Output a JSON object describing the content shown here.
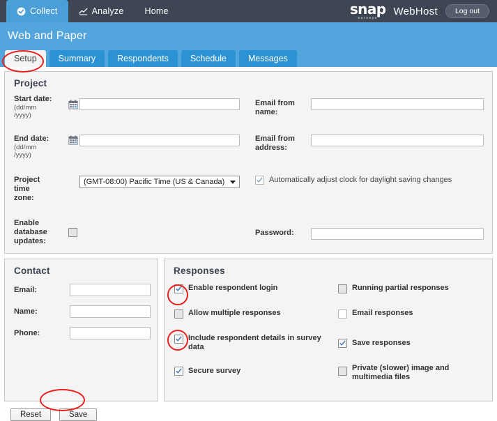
{
  "topnav": {
    "items": [
      {
        "label": "Collect",
        "icon": "check-circle-icon",
        "active": true
      },
      {
        "label": "Analyze",
        "icon": "chart-icon",
        "active": false
      },
      {
        "label": "Home",
        "icon": "",
        "active": false
      }
    ],
    "logo_main": "snap",
    "logo_sub": "surveys",
    "product": "WebHost",
    "logout_label": "Log out"
  },
  "header": {
    "title": "Web and Paper",
    "tabs": [
      {
        "label": "Setup",
        "active": true
      },
      {
        "label": "Summary",
        "active": false
      },
      {
        "label": "Respondents",
        "active": false
      },
      {
        "label": "Schedule",
        "active": false
      },
      {
        "label": "Messages",
        "active": false
      }
    ]
  },
  "project": {
    "title": "Project",
    "start_date": {
      "label": "Start date:",
      "format_hint_1": "(dd/mm",
      "format_hint_2": "/yyyy)",
      "value": "",
      "icon": "calendar-icon"
    },
    "end_date": {
      "label": "End date:",
      "format_hint_1": "(dd/mm",
      "format_hint_2": "/yyyy)",
      "value": "",
      "icon": "calendar-icon"
    },
    "time_zone": {
      "label_1": "Project",
      "label_2": "time",
      "label_3": "zone:",
      "value": "(GMT-08:00) Pacific Time (US & Canada)"
    },
    "enable_db": {
      "label_1": "Enable",
      "label_2": "database",
      "label_3": "updates:",
      "checked": false
    },
    "email_from_name": {
      "label_1": "Email from",
      "label_2": "name:",
      "value": ""
    },
    "email_from_address": {
      "label_1": "Email from",
      "label_2": "address:",
      "value": ""
    },
    "dst": {
      "label": "Automatically adjust clock for daylight saving changes",
      "checked": true
    },
    "password": {
      "label": "Password:",
      "value": ""
    }
  },
  "contact": {
    "title": "Contact",
    "fields": [
      {
        "label": "Email:",
        "value": ""
      },
      {
        "label": "Name:",
        "value": ""
      },
      {
        "label": "Phone:",
        "value": ""
      }
    ]
  },
  "responses": {
    "title": "Responses",
    "left": [
      {
        "label": "Enable respondent login",
        "checked": true,
        "highlighted": true
      },
      {
        "label": "Allow multiple responses",
        "checked": false,
        "highlighted": false
      },
      {
        "label": "Include respondent details in survey data",
        "checked": true,
        "highlighted": true
      },
      {
        "label": "Secure survey",
        "checked": true,
        "highlighted": false
      }
    ],
    "right": [
      {
        "label": "Running partial responses",
        "checked": false,
        "highlighted": false
      },
      {
        "label": "Email responses",
        "checked": false,
        "highlighted": false,
        "disabled": true
      },
      {
        "label": "Save responses",
        "checked": true,
        "highlighted": false
      },
      {
        "label": "Private (slower) image and multimedia files",
        "checked": false,
        "highlighted": false
      }
    ]
  },
  "footer": {
    "reset_label": "Reset",
    "save_label": "Save"
  },
  "colors": {
    "dark_header": "#3e4553",
    "brand_blue": "#52a5dd",
    "tab_blue": "#2b92d4",
    "active_nav_blue": "#4a9fd8",
    "panel_bg": "#f4f4f4",
    "annotation_red": "#e8211c",
    "check_blue": "#4a7ebb"
  }
}
